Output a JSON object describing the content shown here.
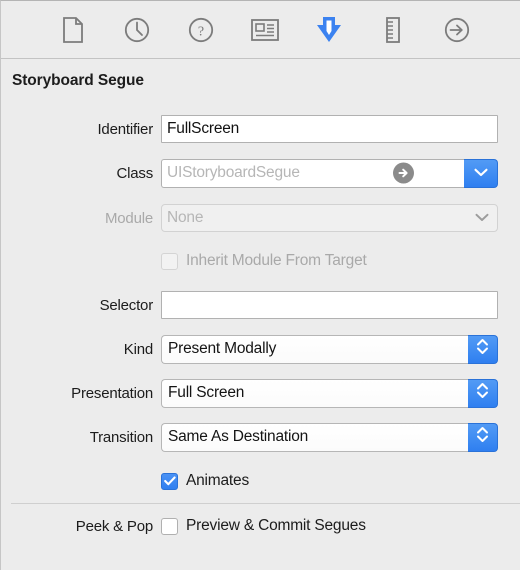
{
  "inspector_toolbar": {
    "tabs": [
      {
        "name": "file-inspector",
        "icon": "document-icon",
        "selected": false
      },
      {
        "name": "history-inspector",
        "icon": "clock-icon",
        "selected": false
      },
      {
        "name": "quick-help-inspector",
        "icon": "question-mark-icon",
        "selected": false
      },
      {
        "name": "identity-inspector",
        "icon": "id-card-icon",
        "selected": false
      },
      {
        "name": "attributes-inspector",
        "icon": "down-arrow-icon",
        "selected": true
      },
      {
        "name": "size-inspector",
        "icon": "ruler-icon",
        "selected": false
      },
      {
        "name": "connections-inspector",
        "icon": "arrow-circle-icon",
        "selected": false
      }
    ],
    "accent_color": "#3b82f0",
    "icon_color": "#7c7c7c"
  },
  "section": {
    "title": "Storyboard Segue"
  },
  "fields": {
    "identifier": {
      "label": "Identifier",
      "value": "FullScreen",
      "placeholder": ""
    },
    "class": {
      "label": "Class",
      "value": "",
      "placeholder": "UIStoryboardSegue"
    },
    "module": {
      "label": "Module",
      "value": "None",
      "enabled": false
    },
    "inherit_module": {
      "label": "Inherit Module From Target",
      "checked": false,
      "enabled": false
    },
    "selector": {
      "label": "Selector",
      "value": "",
      "placeholder": ""
    },
    "kind": {
      "label": "Kind",
      "value": "Present Modally"
    },
    "presentation": {
      "label": "Presentation",
      "value": "Full Screen"
    },
    "transition": {
      "label": "Transition",
      "value": "Same As Destination"
    },
    "animates": {
      "label": "Animates",
      "checked": true
    },
    "peek_and_pop": {
      "label": "Peek & Pop",
      "checkbox_label": "Preview & Commit Segues",
      "checked": false
    }
  }
}
